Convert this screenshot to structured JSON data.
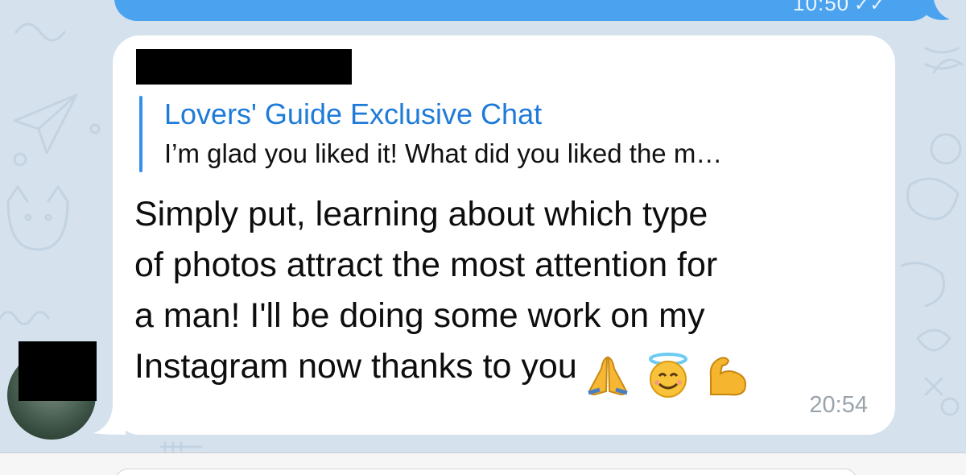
{
  "outgoing_message": {
    "time": "10:50",
    "status_icon": "double-check-icon"
  },
  "incoming_message": {
    "reply_to": {
      "author": "Lovers' Guide Exclusive Chat",
      "preview": "I’m glad you liked it! What did you liked the m…"
    },
    "lines": [
      "Simply put, learning about which type",
      "of photos attract the most attention for",
      "a man! I'll be doing some work on my",
      "Instagram now thanks to you"
    ],
    "emojis": [
      "folded-hands-icon",
      "smiling-face-with-halo-icon",
      "flexed-biceps-icon"
    ],
    "time": "20:54"
  },
  "colors": {
    "chat_background": "#d5e2ee",
    "outgoing_bubble": "#4ba3f0",
    "incoming_bubble": "#ffffff",
    "reply_accent": "#3390ec",
    "time_text": "#9aa3ab"
  }
}
